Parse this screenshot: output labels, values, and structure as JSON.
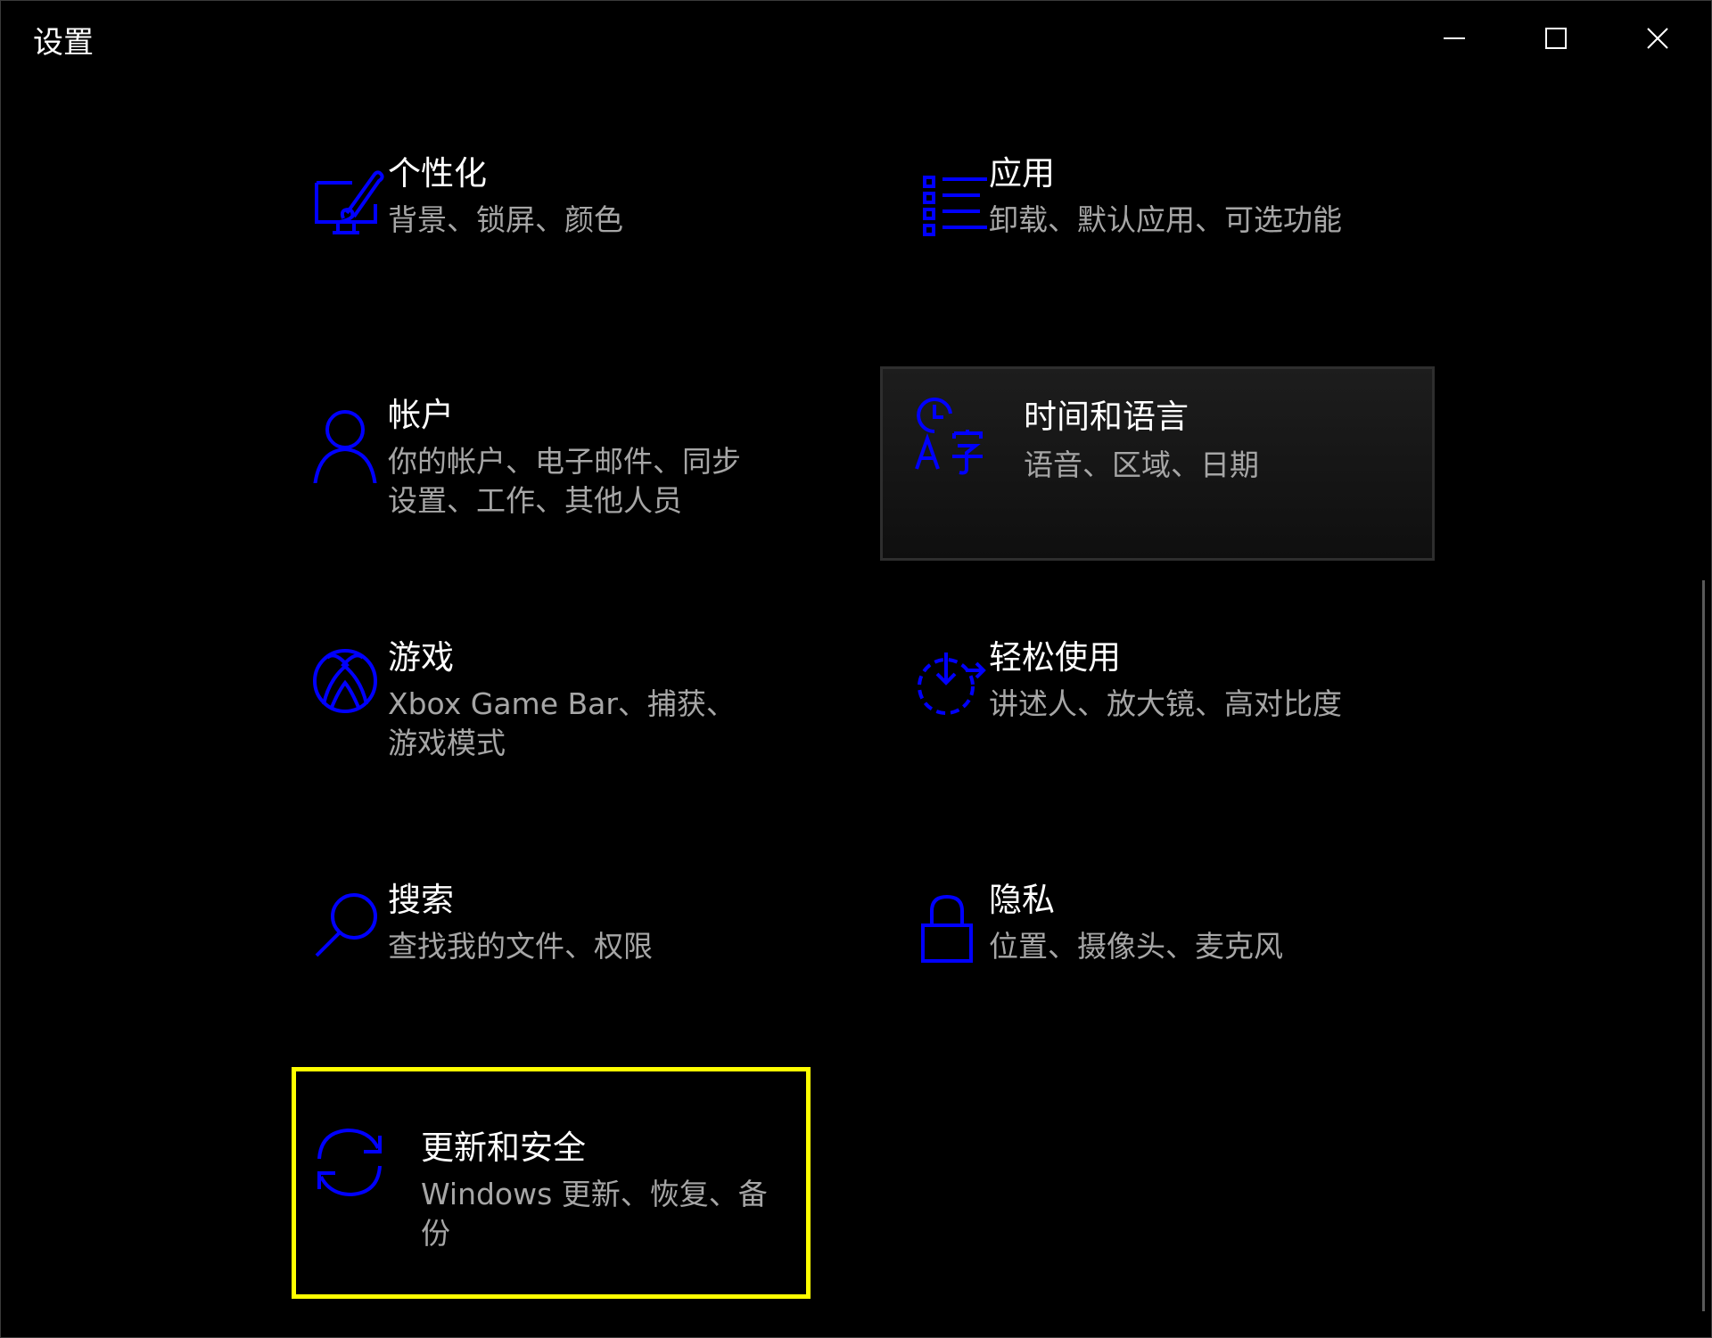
{
  "window": {
    "title": "设置"
  },
  "colors": {
    "background": "#000000",
    "accent": "#0000ff",
    "focus_outline": "#ffff00",
    "text_primary": "#ffffff",
    "text_secondary": "#a6a6a6"
  },
  "tiles": [
    {
      "name": "个性化",
      "desc": "背景、锁屏、颜色",
      "icon": "personalization-icon"
    },
    {
      "name": "应用",
      "desc": "卸载、默认应用、可选功能",
      "icon": "apps-icon"
    },
    {
      "name": "帐户",
      "desc": "你的帐户、电子邮件、同步设置、工作、其他人员",
      "icon": "accounts-icon"
    },
    {
      "name": "时间和语言",
      "desc": "语音、区域、日期",
      "icon": "time-language-icon"
    },
    {
      "name": "游戏",
      "desc": "Xbox Game Bar、捕获、游戏模式",
      "icon": "xbox-icon"
    },
    {
      "name": "轻松使用",
      "desc": "讲述人、放大镜、高对比度",
      "icon": "ease-of-access-icon"
    },
    {
      "name": "搜索",
      "desc": "查找我的文件、权限",
      "icon": "search-icon"
    },
    {
      "name": "隐私",
      "desc": "位置、摄像头、麦克风",
      "icon": "lock-icon"
    },
    {
      "name": "更新和安全",
      "desc": "Windows 更新、恢复、备份",
      "icon": "sync-icon"
    }
  ]
}
